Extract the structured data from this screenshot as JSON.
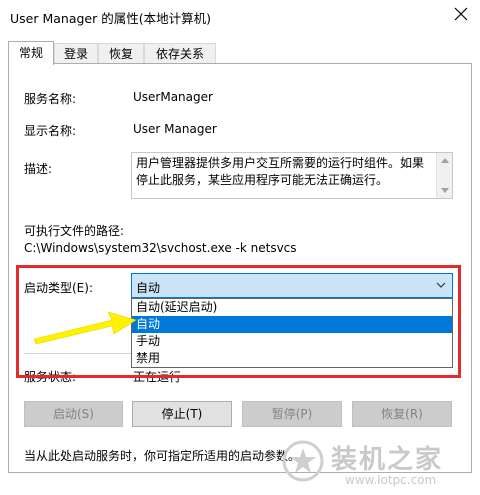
{
  "window": {
    "title": "User Manager 的属性(本地计算机)"
  },
  "tabs": [
    {
      "label": "常规"
    },
    {
      "label": "登录"
    },
    {
      "label": "恢复"
    },
    {
      "label": "依存关系"
    }
  ],
  "general": {
    "service_name_label": "服务名称:",
    "service_name_value": "UserManager",
    "display_name_label": "显示名称:",
    "display_name_value": "User Manager",
    "description_label": "描述:",
    "description_text": "用户管理器提供多用户交互所需要的运行时组件。如果停止此服务，某些应用程序可能无法正确运行。",
    "path_label": "可执行文件的路径:",
    "path_value": "C:\\Windows\\system32\\svchost.exe -k netsvcs",
    "startup_type_label": "启动类型(E):",
    "startup_type_selected": "自动",
    "startup_options": [
      "自动(延迟启动)",
      "自动",
      "手动",
      "禁用"
    ],
    "status_label": "服务状态:",
    "status_value": "正在运行"
  },
  "buttons": {
    "start": "启动(S)",
    "stop": "停止(T)",
    "pause": "暂停(P)",
    "resume": "恢复(R)"
  },
  "hint_text": "当从此处启动服务时，你可指定所适用的启动参数。",
  "watermark": {
    "text": "装机之家",
    "url": "www.lotpc.com"
  },
  "colors": {
    "highlight": "#e32b2b",
    "arrow": "#fff200",
    "selection": "#0078d7"
  }
}
